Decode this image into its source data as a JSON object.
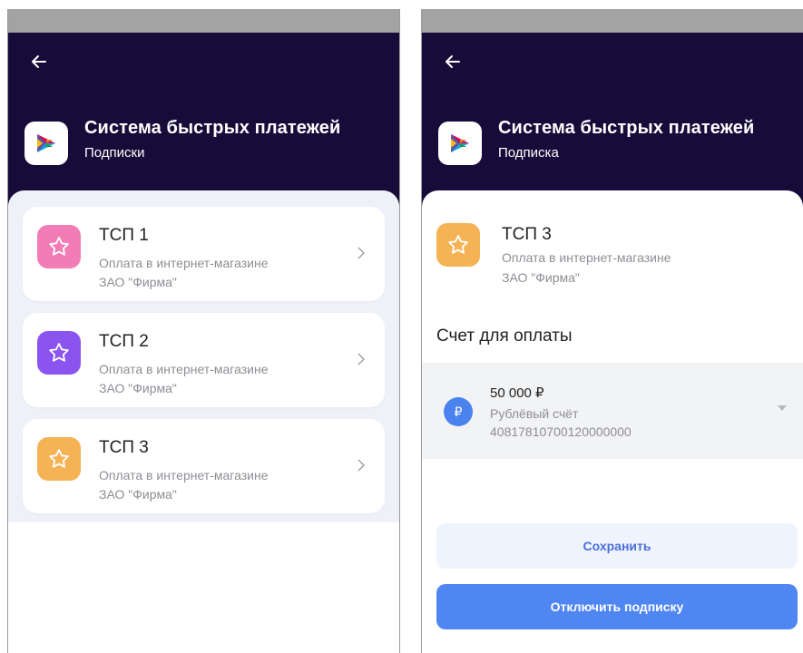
{
  "left_screen": {
    "header": {
      "title": "Система быстрых платежей",
      "subtitle": "Подписки"
    },
    "items": [
      {
        "title": "ТСП 1",
        "line1": "Оплата в интернет-магазине",
        "line2": "ЗАО \"Фирма\"",
        "color": "#f27cb5"
      },
      {
        "title": "ТСП 2",
        "line1": "Оплата в интернет-магазине",
        "line2": "ЗАО \"Фирма\"",
        "color": "#8b54f0"
      },
      {
        "title": "ТСП 3",
        "line1": "Оплата в интернет-магазине",
        "line2": "ЗАО \"Фирма\"",
        "color": "#f5b356"
      }
    ]
  },
  "right_screen": {
    "header": {
      "title": "Система быстрых платежей",
      "subtitle": "Подписка"
    },
    "merchant": {
      "title": "ТСП 3",
      "line1": "Оплата в интернет-магазине",
      "line2": "ЗАО \"Фирма\"",
      "color": "#f5b356"
    },
    "section_title": "Счет для оплаты",
    "account": {
      "amount": "50 000 ₽",
      "type": "Рублёвый счёт",
      "number": "40817810700120000000",
      "icon_glyph": "₽"
    },
    "save_label": "Сохранить",
    "disable_label": "Отключить подписку"
  },
  "colors": {
    "header_bg": "#170c39",
    "accent_blue": "#4f86f2"
  }
}
